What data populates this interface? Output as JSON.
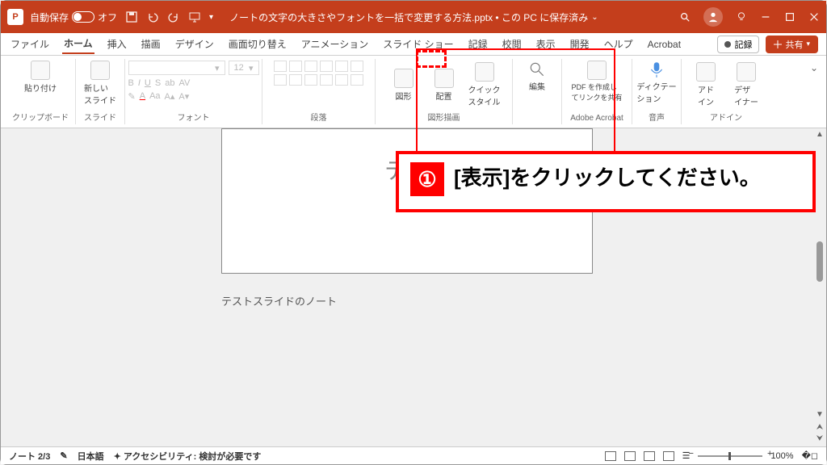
{
  "titlebar": {
    "autosave_label": "自動保存",
    "autosave_state": "オフ",
    "filename": "ノートの文字の大きさやフォントを一括で変更する方法.pptx • この PC に保存済み"
  },
  "tabs": {
    "items": [
      "ファイル",
      "ホーム",
      "挿入",
      "描画",
      "デザイン",
      "画面切り替え",
      "アニメーション",
      "スライド ショー",
      "記録",
      "校閲",
      "表示",
      "開発",
      "ヘルプ",
      "Acrobat"
    ],
    "active_index": 1,
    "record_btn": "記録",
    "share_btn": "共有"
  },
  "ribbon": {
    "clipboard": {
      "paste": "貼り付け",
      "label": "クリップボード"
    },
    "slides": {
      "new_slide": "新しい\nスライド",
      "label": "スライド"
    },
    "font": {
      "size": "12",
      "label": "フォント"
    },
    "paragraph": {
      "label": "段落"
    },
    "drawing": {
      "shapes": "図形",
      "arrange": "配置",
      "quick": "クイック\nスタイル",
      "label": "図形描画"
    },
    "editing": {
      "label": "編集"
    },
    "acrobat": {
      "btn": "PDF を作成し\nてリンクを共有",
      "label": "Adobe Acrobat"
    },
    "voice": {
      "btn": "ディクテー\nション",
      "label": "音声"
    },
    "addin": {
      "a": "アド\nイン",
      "b": "デザ\nイナー",
      "label": "アドイン"
    }
  },
  "slide": {
    "text": "テス",
    "note": "テストスライドのノート"
  },
  "statusbar": {
    "page": "ノート 2/3",
    "lang": "日本語",
    "access": "アクセシビリティ: 検討が必要です",
    "zoom": "100%"
  },
  "callout": {
    "num": "①",
    "text": "[表示]をクリックしてください。"
  }
}
